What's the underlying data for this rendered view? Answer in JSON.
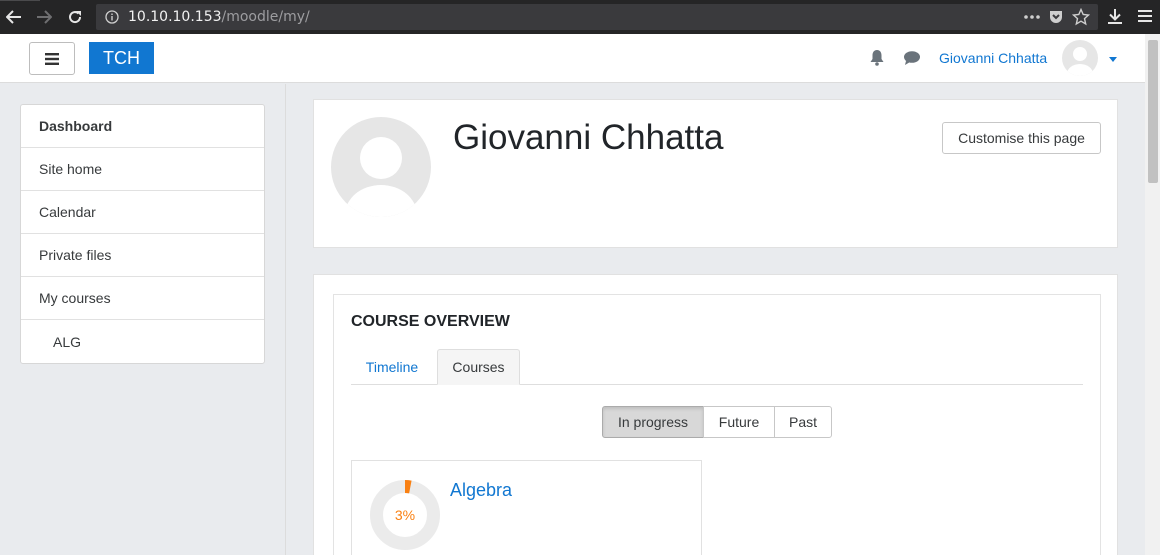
{
  "browser": {
    "url_host": "10.10.10.153",
    "url_path": "/moodle/my/"
  },
  "navbar": {
    "brand": "TCH",
    "username": "Giovanni Chhatta"
  },
  "nav": {
    "items": [
      {
        "label": "Dashboard"
      },
      {
        "label": "Site home"
      },
      {
        "label": "Calendar"
      },
      {
        "label": "Private files"
      },
      {
        "label": "My courses"
      },
      {
        "label": "ALG"
      }
    ]
  },
  "header": {
    "fullname": "Giovanni Chhatta",
    "customise_label": "Customise this page"
  },
  "course_overview": {
    "title": "COURSE OVERVIEW",
    "tabs": [
      {
        "label": "Timeline"
      },
      {
        "label": "Courses"
      }
    ],
    "active_tab": "Courses",
    "filters": [
      {
        "label": "In progress"
      },
      {
        "label": "Future"
      },
      {
        "label": "Past"
      }
    ],
    "active_filter": "In progress",
    "courses": [
      {
        "name": "Algebra",
        "progress_label": "3%",
        "progress_percent": 3
      }
    ]
  },
  "colors": {
    "accent": "#1177d1",
    "progress": "#f98012"
  }
}
